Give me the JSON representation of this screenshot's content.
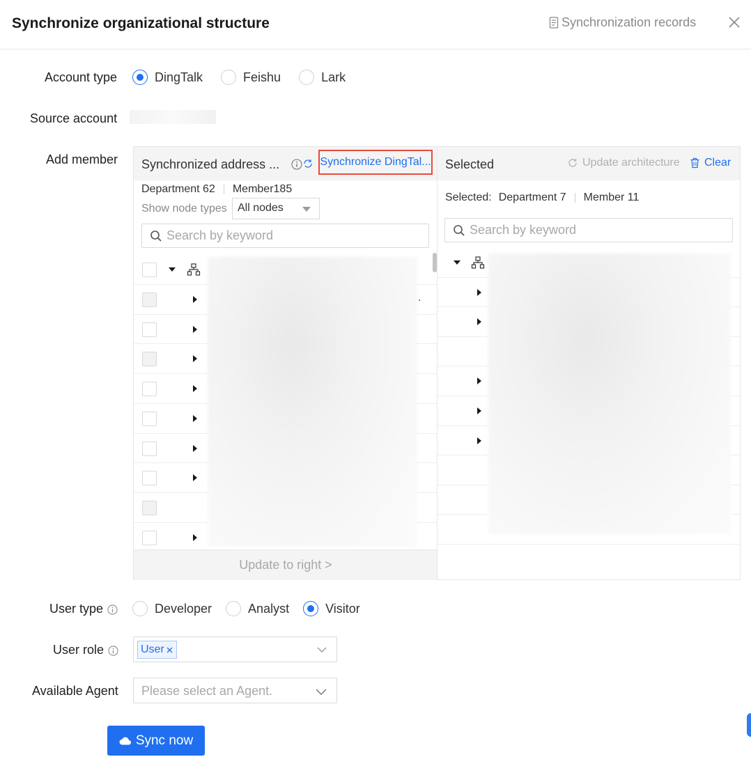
{
  "header": {
    "title": "Synchronize organizational structure",
    "records_label": "Synchronization records"
  },
  "account_type": {
    "label": "Account type",
    "options": [
      "DingTalk",
      "Feishu",
      "Lark"
    ],
    "selected": "DingTalk"
  },
  "source_account": {
    "label": "Source account"
  },
  "add_member": {
    "label": "Add member",
    "left": {
      "title": "Synchronized address ...",
      "sync_link": "Synchronize DingTal...",
      "department_count": "Department 62",
      "member_count": "Member185",
      "show_node_types_label": "Show node types",
      "node_type_value": "All nodes",
      "search_placeholder": "Search by keyword",
      "update_button": "Update to right >"
    },
    "right": {
      "title": "Selected",
      "update_architecture": "Update architecture",
      "clear": "Clear",
      "selected_label": "Selected:",
      "department_count": "Department 7",
      "member_count": "Member 11",
      "search_placeholder": "Search by keyword"
    }
  },
  "user_type": {
    "label": "User type",
    "options": [
      "Developer",
      "Analyst",
      "Visitor"
    ],
    "selected": "Visitor"
  },
  "user_role": {
    "label": "User role",
    "tags": [
      "User"
    ]
  },
  "available_agent": {
    "label": "Available Agent",
    "placeholder": "Please select an Agent."
  },
  "sync_now": "Sync now",
  "colors": {
    "accent": "#1f6ff0",
    "highlight_border": "#e84a3a"
  }
}
